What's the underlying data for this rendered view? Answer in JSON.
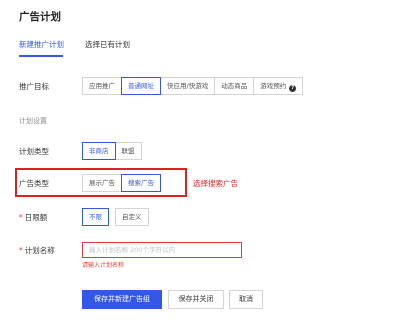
{
  "page": {
    "title": "广告计划"
  },
  "tabs": [
    {
      "label": "新建推广计划",
      "active": true
    },
    {
      "label": "选择已有计划",
      "active": false
    }
  ],
  "form": {
    "target": {
      "label": "推广目标",
      "options": [
        "应用推广",
        "普通网址",
        "快应用/快游戏",
        "动态商品",
        "游戏预约"
      ],
      "selected": "普通网址"
    },
    "section_title": "计划设置",
    "plan_type": {
      "label": "计划类型",
      "options": [
        "非商店",
        "联盟"
      ],
      "selected": "非商店"
    },
    "ad_type": {
      "label": "广告类型",
      "options": [
        "展示广告",
        "搜索广告"
      ],
      "selected": "搜索广告"
    },
    "daily_limit": {
      "required_mark": "*",
      "label": "日限额",
      "options": [
        "不限",
        "自定义"
      ],
      "selected": "不限"
    },
    "plan_name": {
      "required_mark": "*",
      "label": "计划名称",
      "placeholder": "输入计划名称 200个字符以内",
      "value": "",
      "error": "请输入计划名称"
    }
  },
  "annotation": {
    "text": "选择搜索广告",
    "color": "#e02020"
  },
  "buttons": {
    "save_new": "保存并新建广告组",
    "save_close": "保存并关闭",
    "cancel": "取消"
  },
  "colors": {
    "accent": "#3357e6",
    "error": "#e4393c"
  }
}
